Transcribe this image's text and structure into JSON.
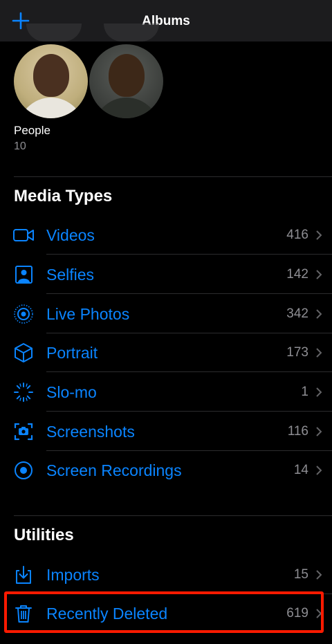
{
  "nav": {
    "title": "Albums",
    "add_icon": "plus-icon"
  },
  "people": {
    "label": "People",
    "count": "10"
  },
  "media_types": {
    "title": "Media Types",
    "items": [
      {
        "label": "Videos",
        "count": "416",
        "icon": "video-icon"
      },
      {
        "label": "Selfies",
        "count": "142",
        "icon": "selfie-icon"
      },
      {
        "label": "Live Photos",
        "count": "342",
        "icon": "live-photo-icon"
      },
      {
        "label": "Portrait",
        "count": "173",
        "icon": "cube-icon"
      },
      {
        "label": "Slo-mo",
        "count": "1",
        "icon": "slo-mo-icon"
      },
      {
        "label": "Screenshots",
        "count": "116",
        "icon": "screenshot-icon"
      },
      {
        "label": "Screen Recordings",
        "count": "14",
        "icon": "screen-record-icon"
      }
    ]
  },
  "utilities": {
    "title": "Utilities",
    "items": [
      {
        "label": "Imports",
        "count": "15",
        "icon": "import-icon"
      },
      {
        "label": "Recently Deleted",
        "count": "619",
        "icon": "trash-icon"
      }
    ]
  },
  "colors": {
    "accent": "#0a84ff",
    "highlight": "#ff1a00",
    "secondary": "#8e8e93"
  }
}
